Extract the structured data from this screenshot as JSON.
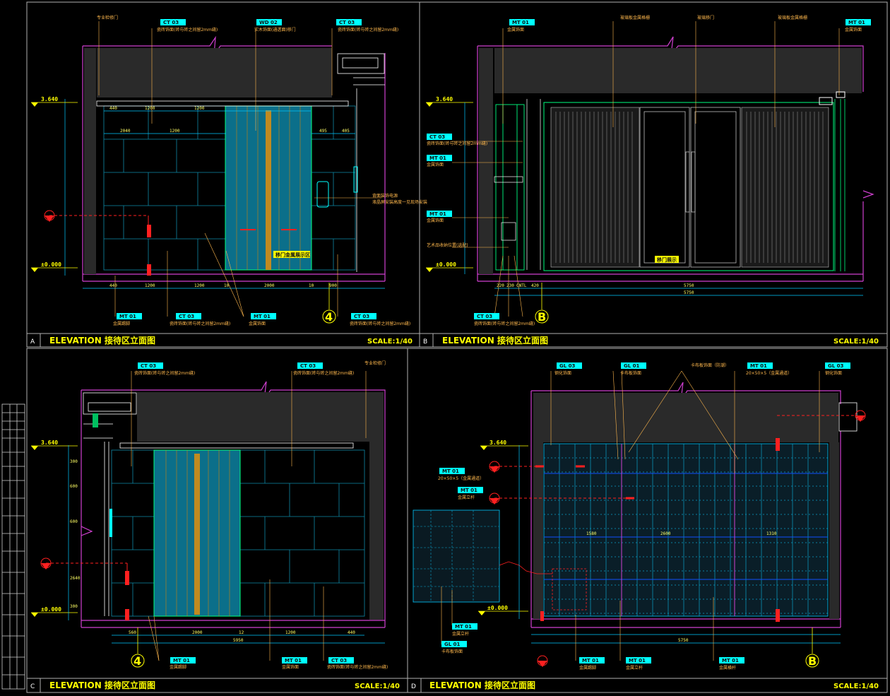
{
  "panels": [
    {
      "letter": "A",
      "title": "ELEVATION  接待区立面图",
      "scale": "SCALE:1/40"
    },
    {
      "letter": "B",
      "title": "ELEVATION  接待区立面图",
      "scale": "SCALE:1/40"
    },
    {
      "letter": "C",
      "title": "ELEVATION  接待区立面图",
      "scale": "SCALE:1/40"
    },
    {
      "letter": "D",
      "title": "ELEVATION  接待区立面图",
      "scale": "SCALE:1/40"
    }
  ],
  "levels": {
    "top": "3.640",
    "zero": "±0.000"
  },
  "tags": {
    "ct03": "CT 03",
    "mt01": "MT 01",
    "wd02": "WD 02",
    "gl03": "GL 03",
    "gl01": "GL 01"
  },
  "notes": {
    "a_top_left": "专业检修门",
    "a_ct03": "瓷砖饰面(砖与砖之间留2mm缝)",
    "a_wd02": "实木饰面(通透面)移门",
    "a_mt01": "金属饰面",
    "a_side": "背面装饰电源",
    "a_side2": "液晶屏安装高度一见现场安装",
    "a_feature": "移门金属展示区",
    "a_bottom_mt": "金属踢脚",
    "b_n1": "玻璃板金属格栅",
    "b_n2": "玻璃移门",
    "b_n3": "玻璃板金属格栅",
    "b_ct03": "瓷砖饰面(砖与砖之间留2mm缝)",
    "b_mt01": "金属饰面",
    "b_mt01b": "金属饰面",
    "b_art": "艺术品收纳位置(选配)",
    "b_feature": "移门展示",
    "d_n1": "钢化饰面",
    "d_n2": "卡布板饰面",
    "d_n3": "卡布板饰面（防潮）",
    "d_n4": "20×50×5（金属通道）",
    "d_n5": "钢化饰面",
    "d_n6": "金属立杆",
    "d_n7": "卡布板饰面",
    "d_n8": "金属踢脚",
    "d_n9": "金属立杆",
    "d_n10": "金属横杆"
  },
  "grids": {
    "a": "4",
    "b": "B",
    "c": "4",
    "d": "B"
  },
  "dims": {
    "a_top": [
      "440",
      "1200",
      "1200"
    ],
    "a_row2": [
      "2040",
      "1200"
    ],
    "a_right": [
      "495",
      "405"
    ],
    "a_bottom": [
      "440",
      "1200",
      "1200",
      "10",
      "2000",
      "10",
      "900"
    ],
    "b_bottom": [
      "220",
      "230",
      "CNTL",
      "420"
    ],
    "b_total": "5750",
    "c_bottom": [
      "560",
      "2000",
      "12",
      "1200",
      "440"
    ],
    "c_total": "5950",
    "d_total": "5750",
    "d_mid": [
      "1580",
      "2600",
      "1310"
    ],
    "v_left": [
      "300",
      "600",
      "600",
      "2640",
      "300"
    ]
  }
}
